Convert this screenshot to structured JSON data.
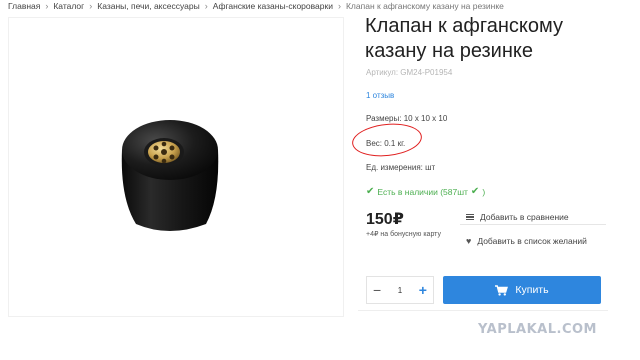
{
  "breadcrumb": [
    {
      "label": "Главная"
    },
    {
      "label": "Каталог"
    },
    {
      "label": "Казаны, печи, аксессуары"
    },
    {
      "label": "Афганские казаны-скороварки"
    },
    {
      "label": "Клапан к афганскому казану на резинке"
    }
  ],
  "breadcrumb_separator": "›",
  "product": {
    "title": "Клапан к афганскому казану на резинке",
    "sku": "Артикул: GM24-P01954",
    "reviews": "1 отзыв",
    "sizes": "Размеры: 10 х 10 х 10",
    "weight": "Вес: 0.1 кг.",
    "unit": "Ед. измерения: шт",
    "stock": "Есть в наличии (587шт",
    "stock_end": ")",
    "price": "150₽",
    "bonus": "+4₽ на бонусную карту",
    "quantity": "1"
  },
  "actions": {
    "compare": "Добавить в сравнение",
    "wishlist": "Добавить в список желаний",
    "buy": "Купить"
  },
  "icons": {
    "check": "✔",
    "heart": "♥",
    "minus": "−",
    "plus": "+"
  },
  "colors": {
    "accent": "#2e86de",
    "in_stock": "#4caf50",
    "annotation": "#e02020"
  },
  "watermark": "YAPLAKAL.COM"
}
